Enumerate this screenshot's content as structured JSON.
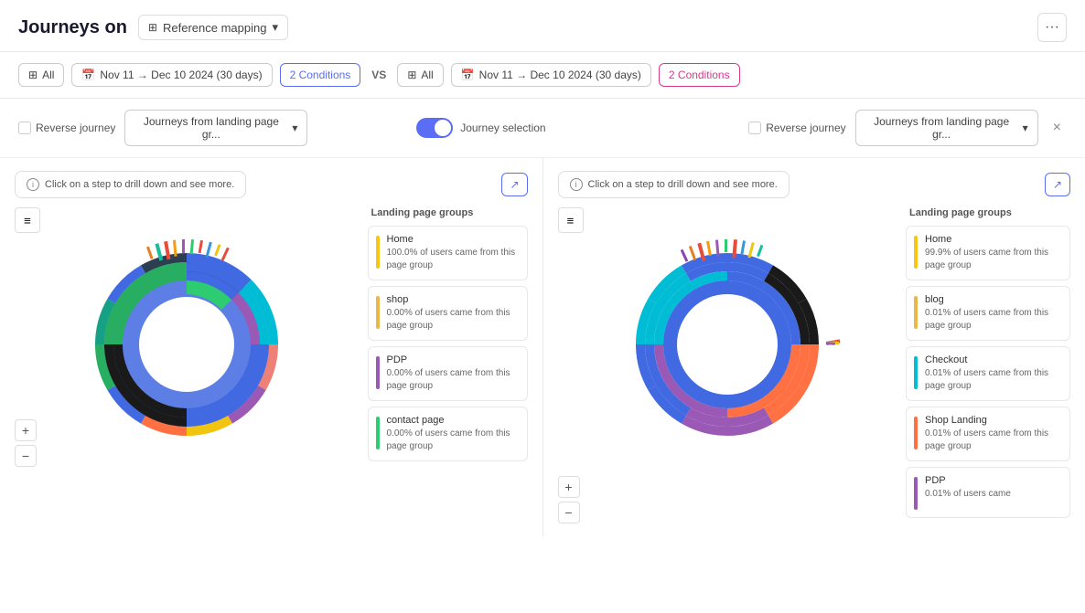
{
  "header": {
    "title": "Journeys on",
    "ref_mapping_label": "Reference mapping",
    "more_btn_label": "..."
  },
  "filters": {
    "left": {
      "all_label": "All",
      "date_range": "Nov 11 → Dec 10 2024 (30 days)",
      "conditions_label": "2 Conditions"
    },
    "vs_label": "VS",
    "right": {
      "all_label": "All",
      "date_range": "Nov 11 → Dec 10 2024 (30 days)",
      "conditions_label": "2 Conditions"
    }
  },
  "controls": {
    "left": {
      "reverse_journey_label": "Reverse journey",
      "journey_select_label": "Journeys from landing page gr..."
    },
    "middle": {
      "toggle_label": "Journey selection"
    },
    "right": {
      "reverse_journey_label": "Reverse journey",
      "journey_select_label": "Journeys from landing page gr...",
      "close_label": "×"
    }
  },
  "panel_left": {
    "drill_hint": "Click on a step to drill down and see more.",
    "legend_title": "Landing page groups",
    "legend_items": [
      {
        "color": "#f5c518",
        "name": "Home",
        "pct": "100.0% of users came from this page group"
      },
      {
        "color": "#e8b84b",
        "name": "shop",
        "pct": "0.00% of users came from this page group"
      },
      {
        "color": "#9b59b6",
        "name": "PDP",
        "pct": "0.00% of users came from this page group"
      },
      {
        "color": "#2ecc71",
        "name": "contact page",
        "pct": "0.00% of users came from this page group"
      }
    ]
  },
  "panel_right": {
    "drill_hint": "Click on a step to drill down and see more.",
    "legend_title": "Landing page groups",
    "legend_items": [
      {
        "color": "#f5c518",
        "name": "Home",
        "pct": "99.9% of users came from this page group"
      },
      {
        "color": "#e8b84b",
        "name": "blog",
        "pct": "0.01% of users came from this page group"
      },
      {
        "color": "#00bcd4",
        "name": "Checkout",
        "pct": "0.01% of users came from this page group"
      },
      {
        "color": "#ff7043",
        "name": "Shop Landing",
        "pct": "0.01% of users came from this page group"
      },
      {
        "color": "#9b59b6",
        "name": "PDP",
        "pct": "0.01% of users came"
      }
    ]
  },
  "icons": {
    "chevron_down": "▾",
    "map_icon": "⊞",
    "calendar_icon": "📅",
    "expand_icon": "↗",
    "menu_icon": "≡",
    "plus_icon": "+",
    "minus_icon": "−",
    "info_icon": "i",
    "close_icon": "×"
  }
}
